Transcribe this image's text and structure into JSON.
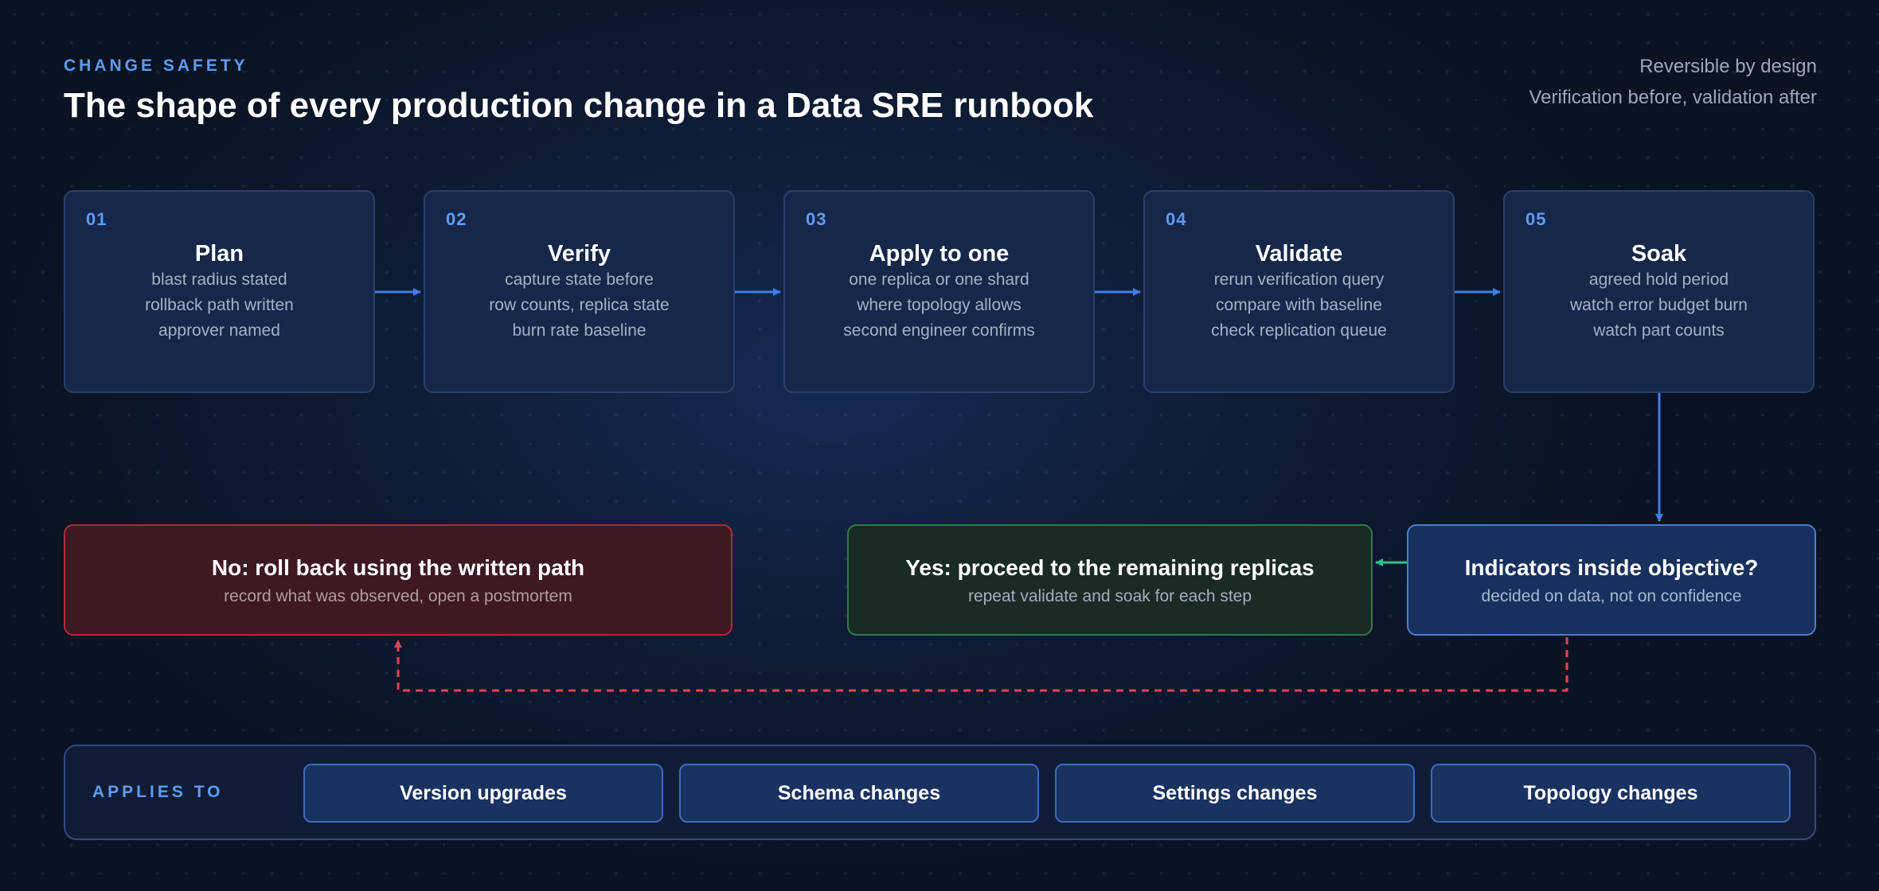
{
  "header": {
    "eyebrow": "CHANGE SAFETY",
    "title": "The shape of every production change in a Data SRE runbook",
    "meta_line_1": "Reversible by design",
    "meta_line_2": "Verification before, validation after"
  },
  "steps": [
    {
      "num": "01",
      "name": "Plan",
      "lines": [
        "blast radius stated",
        "rollback path written",
        "approver named"
      ]
    },
    {
      "num": "02",
      "name": "Verify",
      "lines": [
        "capture state before",
        "row counts, replica state",
        "burn rate baseline"
      ]
    },
    {
      "num": "03",
      "name": "Apply to one",
      "lines": [
        "one replica or one shard",
        "where topology allows",
        "second engineer confirms"
      ]
    },
    {
      "num": "04",
      "name": "Validate",
      "lines": [
        "rerun verification query",
        "compare with baseline",
        "check replication queue"
      ]
    },
    {
      "num": "05",
      "name": "Soak",
      "lines": [
        "agreed hold period",
        "watch error budget burn",
        "watch part counts"
      ]
    }
  ],
  "decision": {
    "title": "Indicators inside objective?",
    "subtitle": "decided on data, not on confidence"
  },
  "outcome_yes": {
    "title": "Yes: proceed to the remaining replicas",
    "subtitle": "repeat validate and soak for each step"
  },
  "outcome_no": {
    "title": "No: roll back using the written path",
    "subtitle": "record what was observed, open a postmortem"
  },
  "applies_to": {
    "label": "APPLIES TO",
    "items": [
      "Version upgrades",
      "Schema changes",
      "Settings changes",
      "Topology changes"
    ]
  },
  "colors": {
    "accent": "#5d9cf2",
    "flow_arrow": "#3d7fe6",
    "yes_arrow": "#2fbf86",
    "no_arrow": "#e0444f"
  }
}
